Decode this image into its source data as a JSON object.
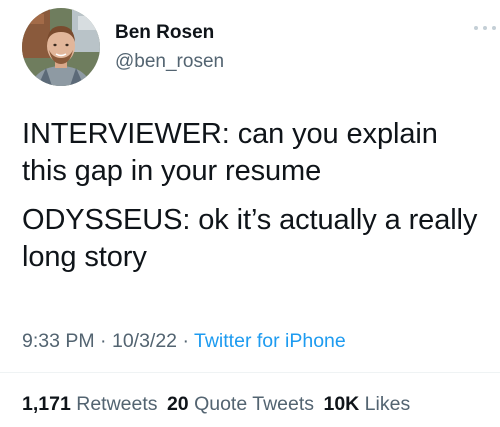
{
  "user": {
    "display_name": "Ben Rosen",
    "handle": "@ben_rosen",
    "avatar_icon": "profile-photo"
  },
  "more_icon": "more-horizontal-icon",
  "tweet": {
    "line1": "INTERVIEWER: can you explain this gap in your resume",
    "line2": "ODYSSEUS: ok it’s actually a really long story"
  },
  "meta": {
    "time": "9:33 PM",
    "sep1": " · ",
    "date": "10/3/22",
    "sep2": " · ",
    "source": "Twitter for iPhone"
  },
  "stats": {
    "retweets_count": "1,171",
    "retweets_label": "Retweets",
    "quotes_count": "20",
    "quotes_label": "Quote Tweets",
    "likes_count": "10K",
    "likes_label": "Likes"
  },
  "colors": {
    "text": "#0f1419",
    "secondary": "#536471",
    "link": "#1d9bf0",
    "divider": "#eff3f4"
  }
}
